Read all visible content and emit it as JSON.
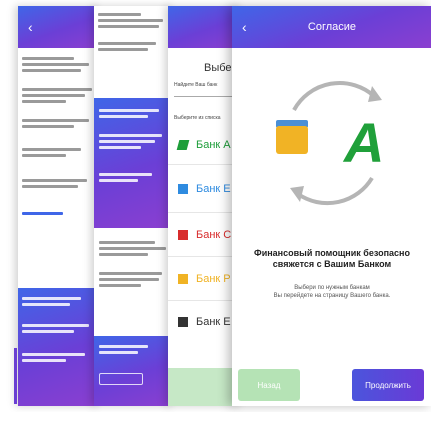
{
  "consent_screen": {
    "title": "Согласие",
    "message_title": "Финансовый помощник безопасно свяжется с Вашим Банком",
    "message_sub": "Выбери по нужным банкам\nВы перейдете на страницу Вашего банка.",
    "back_label": "Назад",
    "next_label": "Продолжить"
  },
  "bank_select": {
    "title": "Выбер",
    "search_hint": "Найдите Ваш банк",
    "section_label": "Выберите из списка",
    "banks": [
      {
        "name": "Банк А",
        "icon": "bank-a-logo",
        "color": "#1e9e3a"
      },
      {
        "name": "Банк Е",
        "icon": "bank-e-logo",
        "color": "#2e8be0"
      },
      {
        "name": "Банк С",
        "icon": "bank-c-logo",
        "color": "#d82c2c"
      },
      {
        "name": "Банк Р",
        "icon": "bank-r-logo",
        "color": "#f0b324"
      },
      {
        "name": "Банк Е",
        "icon": "bank-e2-logo",
        "color": "#333333"
      }
    ]
  },
  "colors": {
    "accent_start": "#3f66e8",
    "accent_end": "#8b3fd0",
    "logo_green": "#20a03a",
    "wallet": "#f1b325"
  }
}
